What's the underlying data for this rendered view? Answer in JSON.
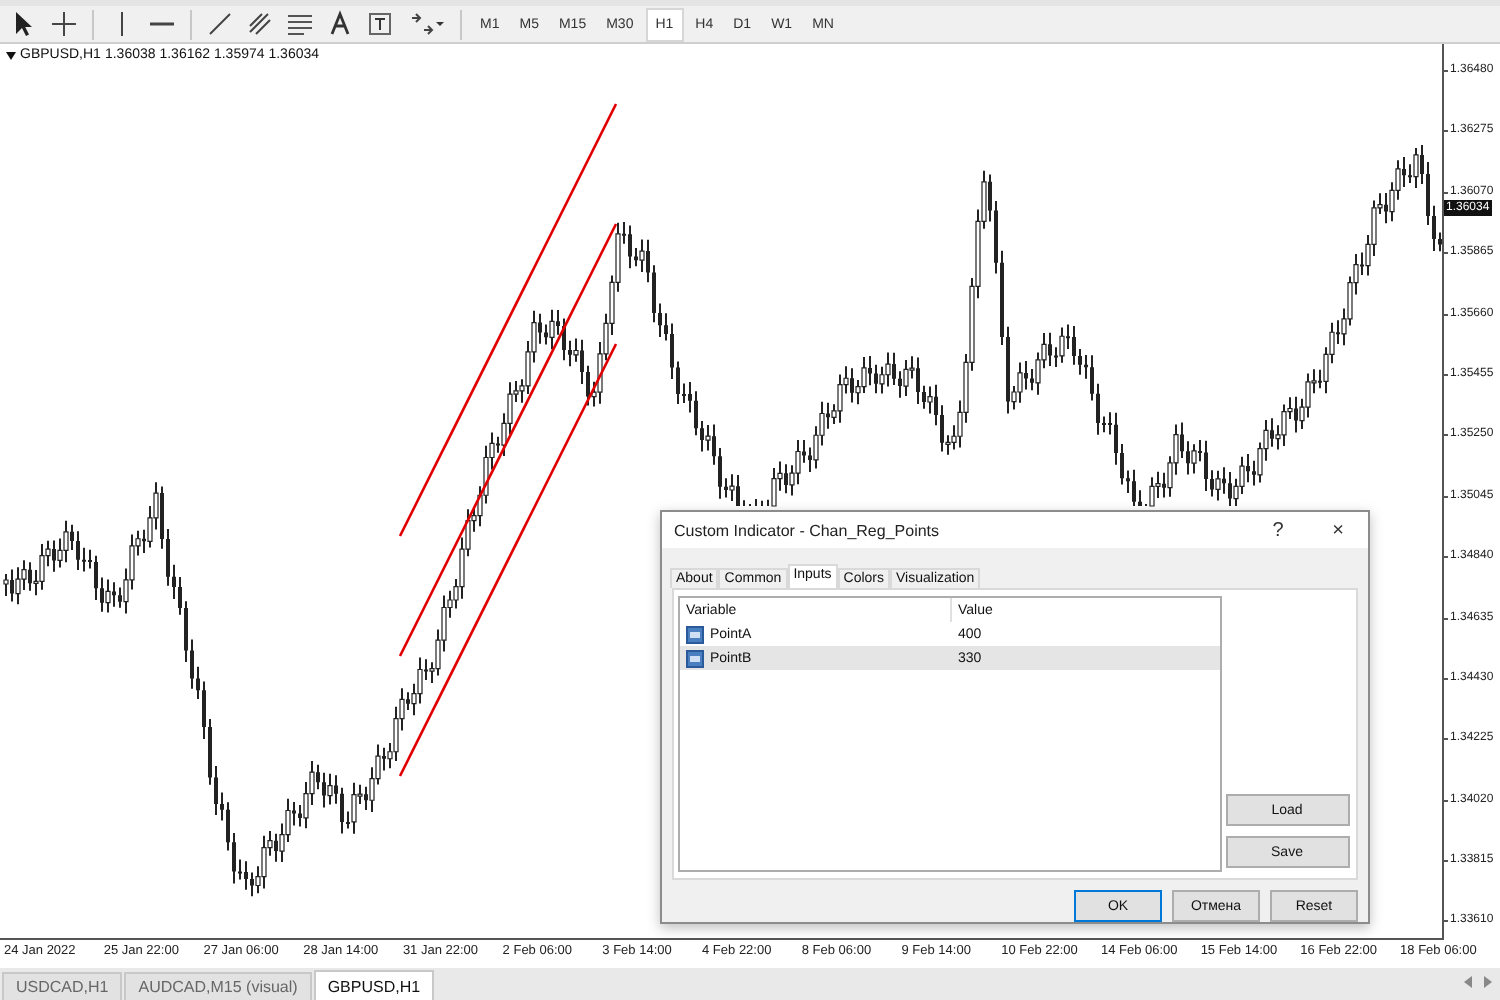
{
  "toolbar": {
    "timeframes": [
      {
        "label": "M1",
        "selected": false
      },
      {
        "label": "M5",
        "selected": false
      },
      {
        "label": "M15",
        "selected": false
      },
      {
        "label": "M30",
        "selected": false
      },
      {
        "label": "H1",
        "selected": true
      },
      {
        "label": "H4",
        "selected": false
      },
      {
        "label": "D1",
        "selected": false
      },
      {
        "label": "W1",
        "selected": false
      },
      {
        "label": "MN",
        "selected": false
      }
    ]
  },
  "chart": {
    "symbol": "GBPUSD,H1",
    "ohlc": "1.36038 1.36162 1.35974 1.36034",
    "current_price": "1.36034",
    "price_labels": [
      "1.36480",
      "1.36275",
      "1.36070",
      "1.35865",
      "1.35660",
      "1.35455",
      "1.35250",
      "1.35045",
      "1.34840",
      "1.34635",
      "1.34430",
      "1.34225",
      "1.34020",
      "1.33815",
      "1.33610"
    ],
    "time_labels": [
      "24 Jan 2022",
      "25 Jan 22:00",
      "27 Jan 06:00",
      "28 Jan 14:00",
      "31 Jan 22:00",
      "2 Feb 06:00",
      "3 Feb 14:00",
      "4 Feb 22:00",
      "8 Feb 06:00",
      "9 Feb 14:00",
      "10 Feb 22:00",
      "14 Feb 06:00",
      "15 Feb 14:00",
      "16 Feb 22:00",
      "18 Feb 06:00"
    ]
  },
  "dialog": {
    "title": "Custom Indicator - Chan_Reg_Points",
    "help": "?",
    "close": "×",
    "tabs": [
      {
        "label": "About",
        "selected": false
      },
      {
        "label": "Common",
        "selected": false
      },
      {
        "label": "Inputs",
        "selected": true
      },
      {
        "label": "Colors",
        "selected": false
      },
      {
        "label": "Visualization",
        "selected": false
      }
    ],
    "table": {
      "columns": [
        "Variable",
        "Value"
      ],
      "rows": [
        {
          "variable": "PointA",
          "value": "400",
          "selected": false
        },
        {
          "variable": "PointB",
          "value": "330",
          "selected": true
        }
      ]
    },
    "side_buttons": [
      "Load",
      "Save"
    ],
    "buttons": [
      {
        "label": "OK",
        "default": true
      },
      {
        "label": "Отмена",
        "default": false
      },
      {
        "label": "Reset",
        "default": false
      }
    ]
  },
  "chart_tabs": [
    {
      "label": "USDCAD,H1",
      "selected": false
    },
    {
      "label": "AUDCAD,M15 (visual)",
      "selected": false
    },
    {
      "label": "GBPUSD,H1",
      "selected": true
    }
  ]
}
